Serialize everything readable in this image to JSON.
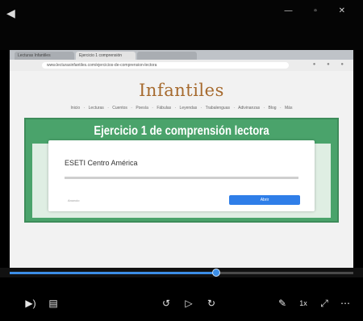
{
  "player": {
    "back_icon": "back-arrow-icon",
    "window_controls": "— ▫ ✕"
  },
  "browser": {
    "tabs": [
      "Lecturas Infantiles",
      "Ejercicio 1 comprensión",
      ""
    ],
    "url": "www.lecturasinfantiles.com/ejercicios-de-comprension-lectora"
  },
  "site": {
    "logo": "Infantiles",
    "nav": "Inicio · Lecturas · Cuentos · Poesía · Fábulas · Leyendas · Trabalenguas · Adivinanzas · Blog · Más",
    "exercise_title": "Ejercicio 1 de comprensión lectora",
    "ad_title": "ESETI Centro América",
    "ad_sub": "Anuncio",
    "ad_button": "Abrir"
  },
  "progress": {
    "fraction": 0.6
  },
  "colors": {
    "accent": "#3c8ee6",
    "panel_green": "#4aa36b",
    "banner": "#b8892b"
  }
}
